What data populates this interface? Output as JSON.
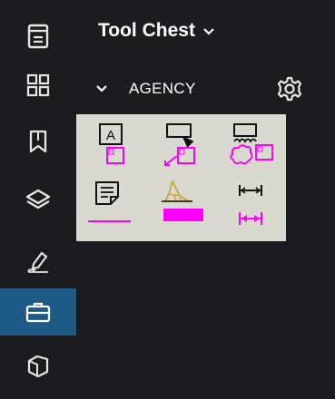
{
  "panel": {
    "title": "Tool Chest",
    "title_chevron_icon": "chevron-down-icon"
  },
  "group": {
    "label": "AGENCY",
    "chevron_icon": "chevron-down-icon",
    "settings_icon": "gear-icon"
  },
  "rail": {
    "items": [
      {
        "icon": "document-icon",
        "active": false
      },
      {
        "icon": "grid-icon",
        "active": false
      },
      {
        "icon": "bookmark-icon",
        "active": false
      },
      {
        "icon": "layers-icon",
        "active": false
      },
      {
        "icon": "signature-icon",
        "active": false
      },
      {
        "icon": "toolbox-icon",
        "active": true
      },
      {
        "icon": "measure-area-icon",
        "active": false
      }
    ]
  },
  "tools": [
    {
      "icon": "text-box-icon",
      "row": 1,
      "col": 1
    },
    {
      "icon": "callout-icon",
      "row": 1,
      "col": 2
    },
    {
      "icon": "cloud-callout-icon",
      "row": 1,
      "col": 3
    },
    {
      "icon": "note-icon",
      "row": 2,
      "col": 1
    },
    {
      "icon": "highlighter-icon",
      "row": 2,
      "col": 2
    },
    {
      "icon": "dimension-icon",
      "row": 2,
      "col": 3
    }
  ],
  "tool_preview_labels": {
    "text_box_letter": "A"
  },
  "colors": {
    "rail_background": "#1a1c1f",
    "panel_background": "#1a1c1f",
    "active_item": "#1d5a85",
    "tool_grid_background": "#d9d9cf",
    "markup_magenta": "#ff00ff",
    "highlighter_tan": "#c9a43a"
  }
}
